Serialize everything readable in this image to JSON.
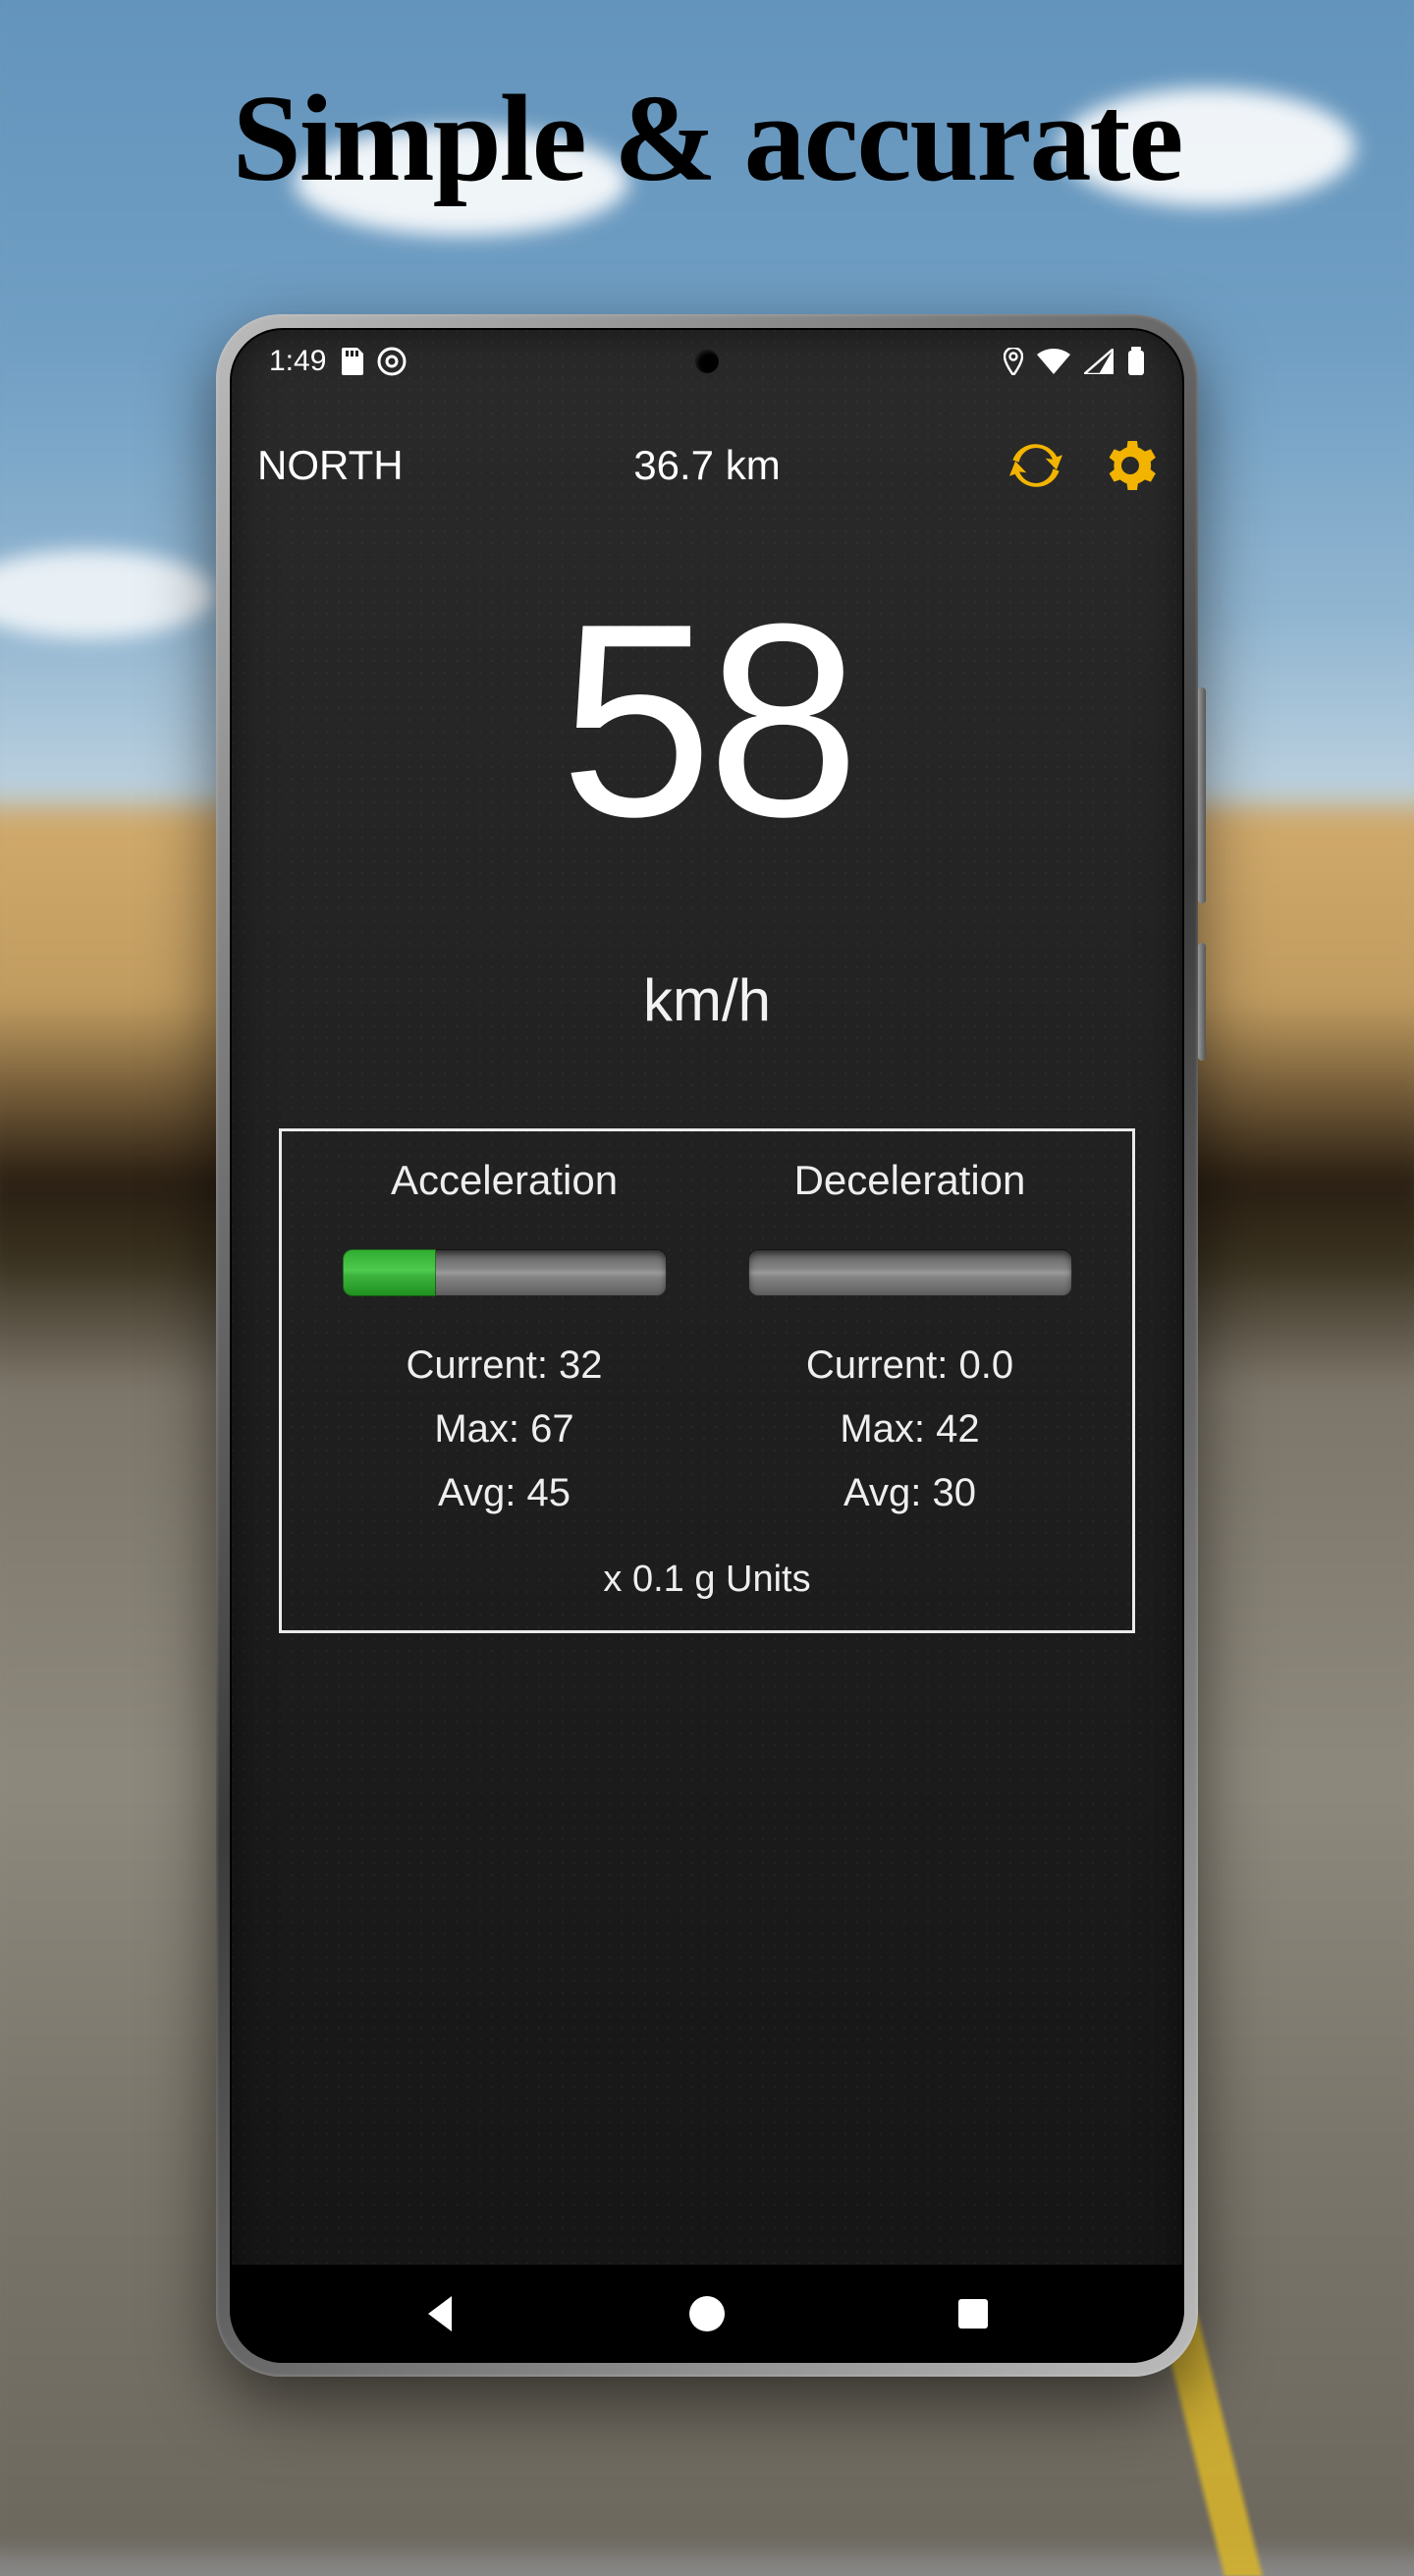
{
  "headline": "Simple & accurate",
  "statusbar": {
    "time": "1:49"
  },
  "header": {
    "direction": "NORTH",
    "distance": "36.7 km",
    "colors": {
      "icon_accent": "#f2b400"
    }
  },
  "speed": {
    "value": "58",
    "unit": "km/h"
  },
  "stats": {
    "accel": {
      "title": "Acceleration",
      "fill_percent": 29,
      "current_label": "Current: ",
      "current": "32",
      "max_label": "Max: ",
      "max": "67",
      "avg_label": "Avg: ",
      "avg": "45"
    },
    "decel": {
      "title": "Deceleration",
      "fill_percent": 0,
      "current_label": "Current: ",
      "current": "0.0",
      "max_label": "Max: ",
      "max": "42",
      "avg_label": "Avg: ",
      "avg": "30"
    },
    "units_footer": "x 0.1 g Units"
  }
}
